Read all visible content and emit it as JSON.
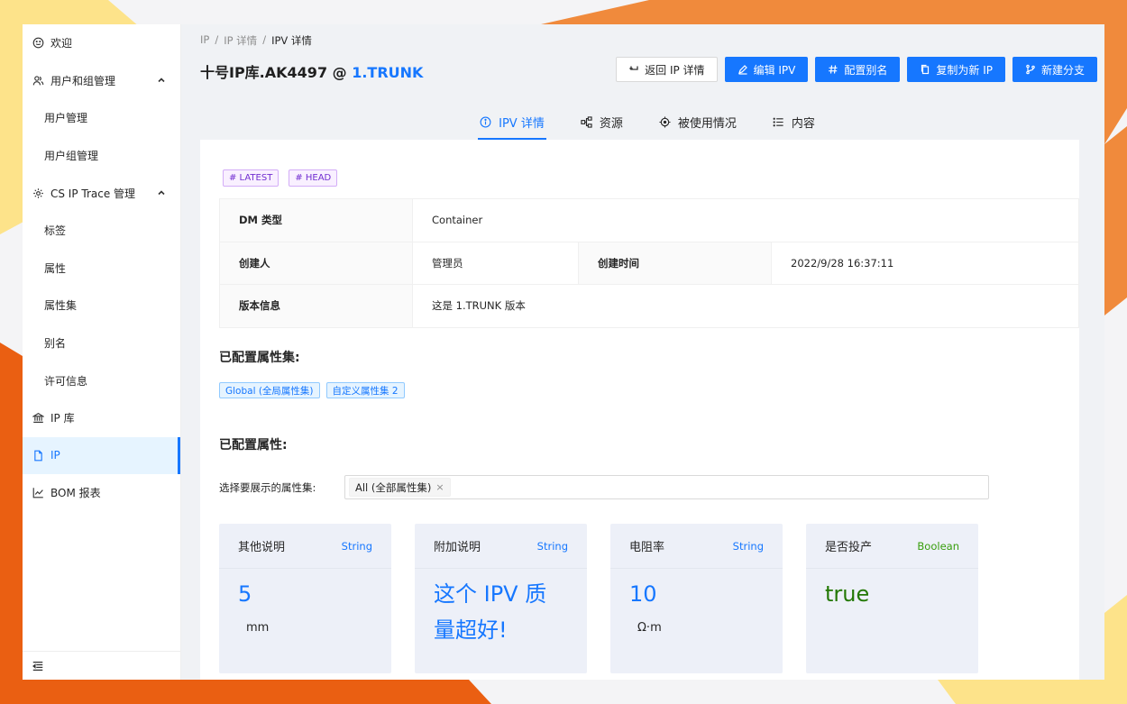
{
  "sidebar": {
    "items": [
      {
        "label": "欢迎"
      },
      {
        "label": "用户和组管理"
      },
      {
        "label": "用户管理"
      },
      {
        "label": "用户组管理"
      },
      {
        "label": "CS IP Trace 管理"
      },
      {
        "label": "标签"
      },
      {
        "label": "属性"
      },
      {
        "label": "属性集"
      },
      {
        "label": "别名"
      },
      {
        "label": "许可信息"
      },
      {
        "label": "IP 库"
      },
      {
        "label": "IP"
      },
      {
        "label": "BOM 报表"
      }
    ]
  },
  "breadcrumb": [
    "IP",
    "/",
    "IP 详情",
    "/",
    "IPV 详情"
  ],
  "title": {
    "prefix": "十号IP库.AK4497 @ ",
    "highlight": "1.TRUNK"
  },
  "toolbar": {
    "back": "返回 IP 详情",
    "edit": "编辑 IPV",
    "alias": "配置别名",
    "copy": "复制为新 IP",
    "branch": "新建分支"
  },
  "tabs": [
    "IPV 详情",
    "资源",
    "被使用情况",
    "内容"
  ],
  "version_tags": [
    "# LATEST",
    "# HEAD"
  ],
  "details": {
    "dm_type_label": "DM 类型",
    "dm_type_value": "Container",
    "creator_label": "创建人",
    "creator_value": "管理员",
    "created_time_label": "创建时间",
    "created_time_value": "2022/9/28 16:37:11",
    "version_info_label": "版本信息",
    "version_info_value": "这是 1.TRUNK 版本"
  },
  "attr_sets_section": {
    "title": "已配置属性集:",
    "tags": [
      "Global (全局属性集)",
      "自定义属性集 2"
    ]
  },
  "attrs_section": {
    "title": "已配置属性:",
    "select_label": "选择要展示的属性集:",
    "selected": "All (全部属性集)",
    "remove": "×"
  },
  "cards": [
    {
      "name": "其他说明",
      "type": "String",
      "value": "5",
      "unit": "mm"
    },
    {
      "name": "附加说明",
      "type": "String",
      "value": "这个 IPV 质量超好!",
      "unit": ""
    },
    {
      "name": "电阻率",
      "type": "String",
      "value": "10",
      "unit": "Ω·m"
    },
    {
      "name": "是否投产",
      "type": "Boolean",
      "value": "true",
      "unit": ""
    }
  ],
  "colors": {
    "primary": "#1677ff",
    "boolean": "#237804",
    "tag_purple": "#722ed1"
  }
}
